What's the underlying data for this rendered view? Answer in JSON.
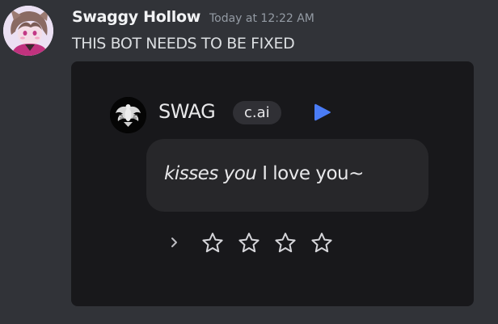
{
  "message": {
    "username": "Swaggy Hollow",
    "timestamp": "Today at 12:22 AM",
    "content": "THIS BOT NEEDS TO BE FIXED"
  },
  "attachment": {
    "bot_name": "SWAG",
    "bot_badge": "c.ai",
    "play_icon": "play-icon",
    "reply": {
      "emote": "kisses you",
      "text": " I love you~"
    },
    "next_icon": "chevron-right-icon",
    "rating": {
      "max_stars": 4,
      "filled": 0,
      "icon": "star-outline-icon"
    }
  },
  "colors": {
    "background": "#313338",
    "attachment_background": "#18181b",
    "bubble": "#27272a",
    "accent_blue": "#4a7cf6",
    "username": "#f2f3f5",
    "timestamp": "#949ba4",
    "text": "#dbdee1"
  }
}
